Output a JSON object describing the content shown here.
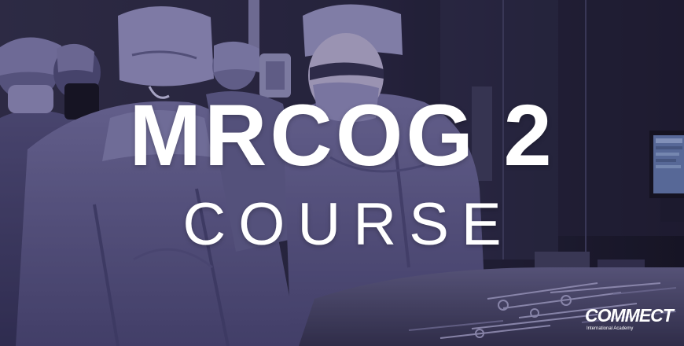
{
  "banner": {
    "title": "MRCOG 2",
    "subtitle": "COURSE"
  },
  "logo": {
    "wordmark": "COMMECT",
    "tagline": "International Academy"
  },
  "colors": {
    "overlay": "#2e285c",
    "text": "#ffffff"
  }
}
